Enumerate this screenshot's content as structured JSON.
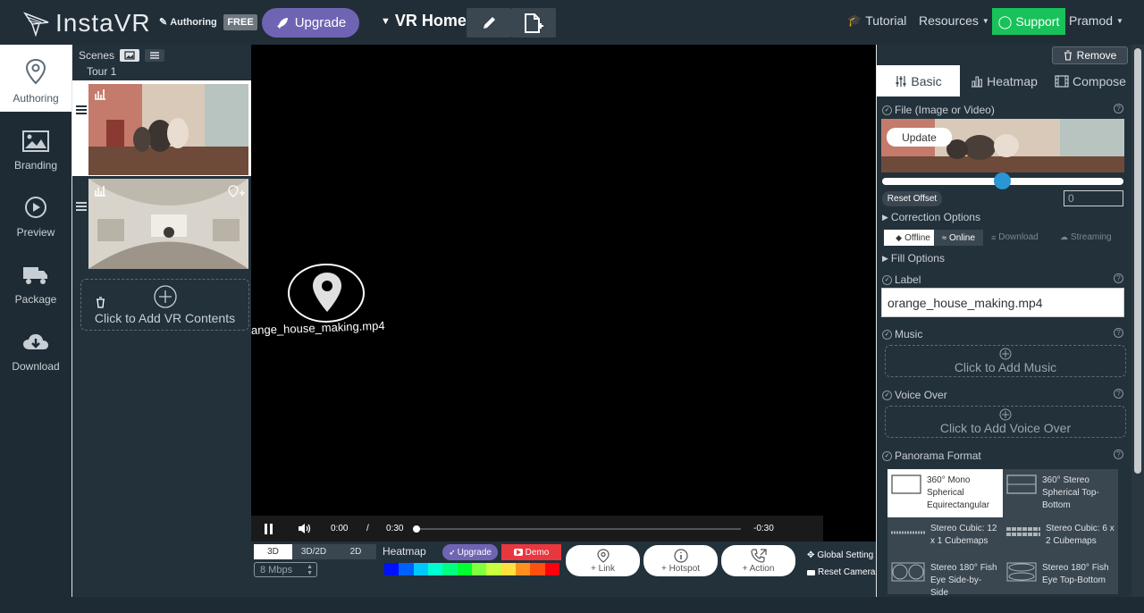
{
  "topbar": {
    "logo_text": "InstaVR",
    "authoring_label": "Authoring",
    "free_badge": "FREE",
    "upgrade_label": "Upgrade",
    "vr_home": "VR Home",
    "tutorial": "Tutorial",
    "resources": "Resources",
    "support": "Support",
    "user": "Pramod"
  },
  "leftnav": {
    "items": [
      {
        "label": "Authoring",
        "icon": "map-pin-icon"
      },
      {
        "label": "Branding",
        "icon": "image-icon"
      },
      {
        "label": "Preview",
        "icon": "play-circle-icon"
      },
      {
        "label": "Package",
        "icon": "truck-icon"
      },
      {
        "label": "Download",
        "icon": "cloud-download-icon"
      }
    ]
  },
  "scenes": {
    "title": "Scenes",
    "tour": "Tour 1",
    "add_label": "Click to Add VR Contents"
  },
  "viewer": {
    "hotspot_label": "ange_house_making.mp4",
    "time_current": "0:00",
    "time_sep": "/",
    "time_total": "0:30",
    "time_remaining": "-0:30",
    "progress": 0
  },
  "bottombar": {
    "modes": [
      "3D",
      "3D/2D",
      "2D"
    ],
    "bitrate": "8 Mbps",
    "heatmap_label": "Heatmap",
    "heatmap_upgrade": "Upgrade",
    "demo": "Demo",
    "heat_colors": [
      "#0010ff",
      "#0060ff",
      "#00c8ff",
      "#00ffd0",
      "#00ff80",
      "#00ff30",
      "#80ff40",
      "#c8ff40",
      "#ffe040",
      "#ff9020",
      "#ff5010",
      "#ff0010"
    ],
    "add_link": "+ Link",
    "add_hotspot": "+ Hotspot",
    "add_action": "+ Action",
    "global_settings": "Global Setting",
    "reset_camera": "Reset Camera"
  },
  "rightpanel": {
    "remove": "Remove",
    "tabs": [
      "Basic",
      "Heatmap",
      "Compose"
    ],
    "file_label": "File (Image or Video)",
    "update": "Update",
    "slider_value": 0.5,
    "reset_offset": "Reset Offset",
    "offset_value": "0",
    "correction_options": "Correction Options",
    "offline": "Offline",
    "online": "Online",
    "download": "Download",
    "streaming": "Streaming",
    "fill_options": "Fill Options",
    "label_title": "Label",
    "label_value": "orange_house_making.mp4",
    "music_title": "Music",
    "music_add": "Click to Add Music",
    "voice_title": "Voice Over",
    "voice_add": "Click to Add Voice Over",
    "pano_title": "Panorama Format",
    "pano_formats": [
      "360° Mono Spherical Equirectangular",
      "360° Stereo Spherical Top-Bottom",
      "Stereo Cubic: 12 x 1 Cubemaps",
      "Stereo Cubic: 6 x 2 Cubemaps",
      "Stereo 180° Fish Eye Side-by-Side",
      "Stereo 180° Fish Eye Top-Bottom"
    ]
  }
}
